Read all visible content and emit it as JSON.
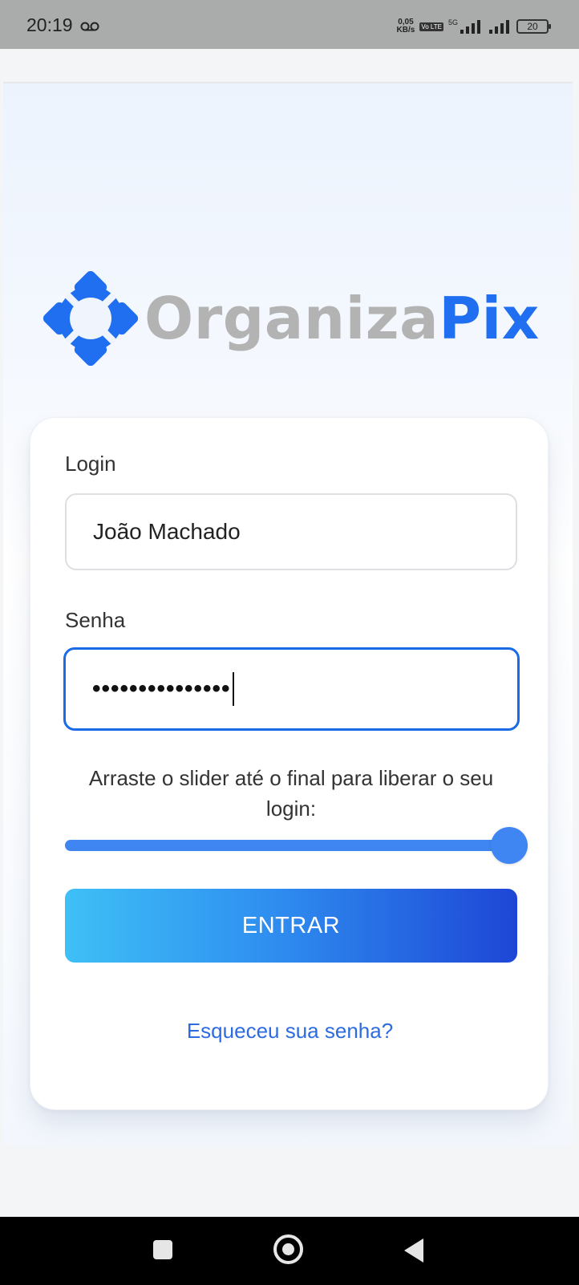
{
  "status_bar": {
    "time": "20:19",
    "voicemail_icon": "voicemail-icon",
    "net_speed_value": "0,05",
    "net_speed_unit": "KB/s",
    "volte_badge": "Vo LTE",
    "network_type": "5G",
    "battery": "20"
  },
  "logo": {
    "text_gray": "Organiza",
    "text_blue": "Pix",
    "colors": {
      "gray": "#b3b3b3",
      "blue": "#1f6ff0"
    }
  },
  "form": {
    "login_label": "Login",
    "login_value": "João Machado",
    "password_label": "Senha",
    "password_value": "•••••••••••••••",
    "slider_text": "Arraste o slider até o final para liberar o seu login:",
    "slider_value": 1.0,
    "enter_button": "ENTRAR",
    "forgot_link": "Esqueceu sua senha?"
  },
  "colors": {
    "accent": "#1c6be6",
    "slider": "#3f86f2",
    "button_gradient_start": "#3ec0f6",
    "button_gradient_end": "#1e46d6",
    "link": "#2d6be0"
  },
  "nav_bar": {
    "recents_icon": "square-icon",
    "home_icon": "home-circle-icon",
    "back_icon": "back-triangle-icon"
  }
}
